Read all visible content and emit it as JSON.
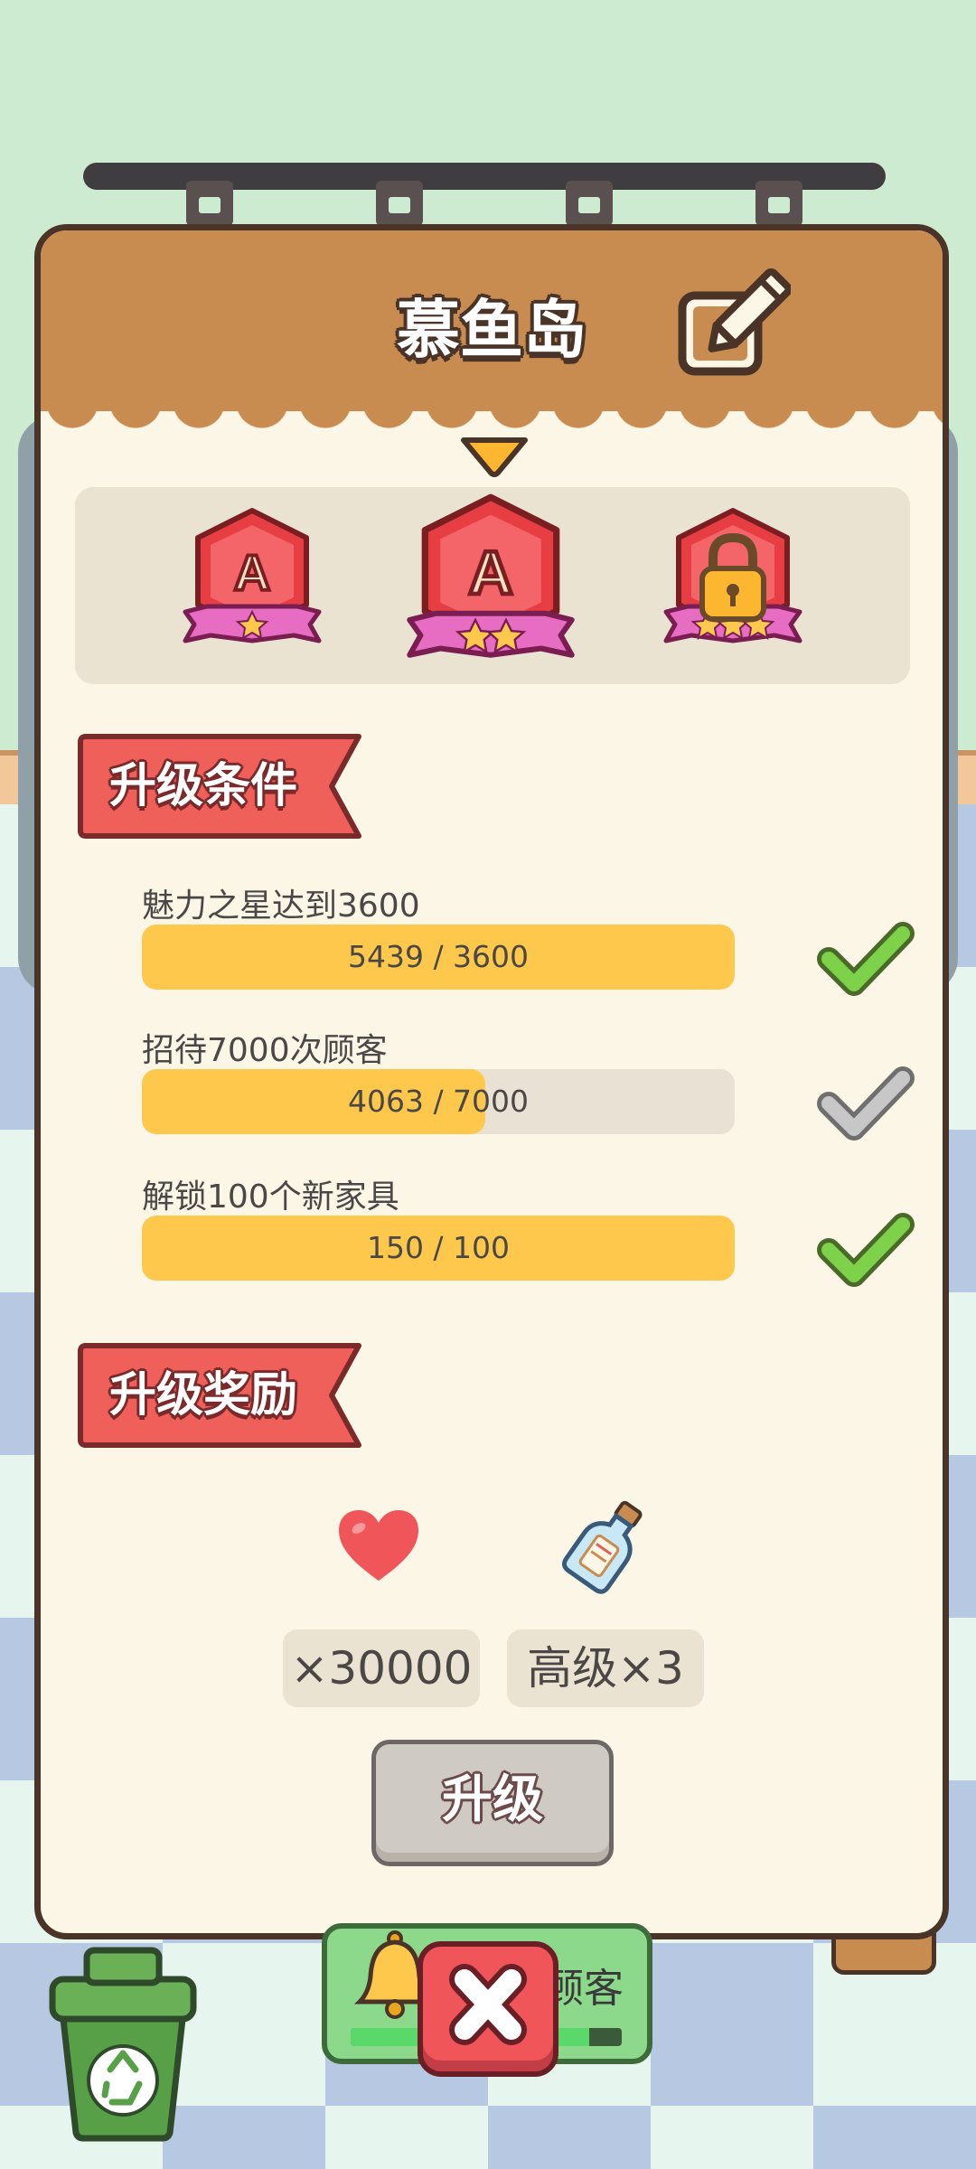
{
  "panel": {
    "title": "慕鱼岛",
    "edit_icon": "pencil-edit-icon"
  },
  "badges": [
    {
      "letter": "A",
      "stars": 1,
      "state": "unlocked"
    },
    {
      "letter": "A",
      "stars": 2,
      "state": "current"
    },
    {
      "letter": "",
      "stars": 3,
      "state": "locked",
      "icon": "padlock-icon"
    }
  ],
  "conditions": {
    "heading": "升级条件",
    "items": [
      {
        "label": "魅力之星达到3600",
        "progress_text": "5439 / 3600",
        "progress": 1.0,
        "done": true
      },
      {
        "label": "招待7000次顾客",
        "progress_text": "4063 / 7000",
        "progress": 0.5804,
        "done": false
      },
      {
        "label": "解锁100个新家具",
        "progress_text": "150 / 100",
        "progress": 1.0,
        "done": true
      }
    ]
  },
  "rewards": {
    "heading": "升级奖励",
    "items": [
      {
        "icon": "heart-icon",
        "amount": "×30000"
      },
      {
        "icon": "message-bottle-icon",
        "amount": "高级×3"
      }
    ]
  },
  "upgrade_button": "升级",
  "bottom": {
    "customer_button_label": "顾客",
    "trash_icon": "recycle-bin-icon",
    "close_icon": "close-x-icon"
  },
  "colors": {
    "progress_fill": "#fdc84c",
    "check_done": "#7ed24a",
    "check_pending": "#c7c7c7",
    "ribbon": "#f0605a",
    "panel_header": "#c98c50"
  }
}
